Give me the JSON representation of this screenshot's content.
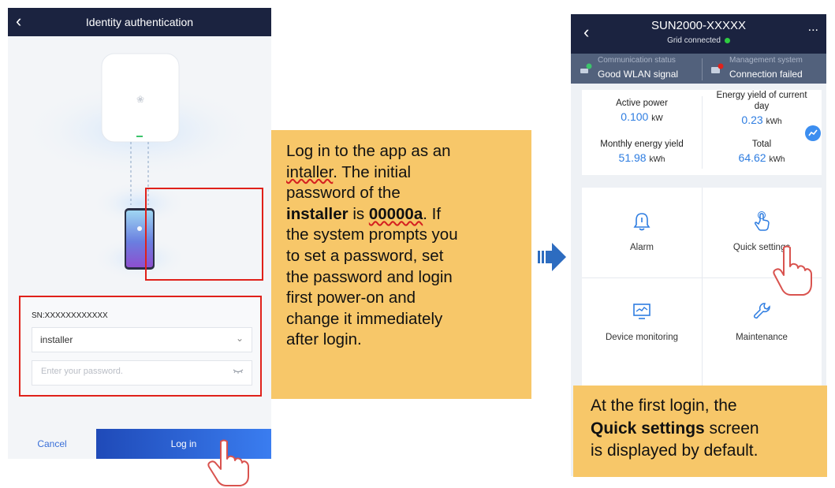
{
  "login_screen": {
    "title": "Identity authentication",
    "sn_label": "SN:XXXXXXXXXXXX",
    "username": "installer",
    "password_placeholder": "Enter your password.",
    "cancel_label": "Cancel",
    "login_label": "Log in"
  },
  "instruction": {
    "line1": "Log in to the app as an",
    "line2_word": "intaller",
    "line2_rest": ". The initial",
    "line3": "password of the",
    "line4_bold": "installer",
    "line4_mid": " is ",
    "line4_pw": "00000a",
    "line4_end": ". If",
    "line5": "the system prompts you",
    "line6": "to set a password, set",
    "line7": "the password and login",
    "line8": "first power-on and",
    "line9": "change it immediately",
    "line10": "after login."
  },
  "inverter_screen": {
    "title": "SUN2000-XXXXX",
    "status": "Grid connected",
    "more_label": "...",
    "comm_label": "Communication status",
    "comm_value": "Good WLAN signal",
    "mgmt_label": "Management system",
    "mgmt_value": "Connection failed",
    "active_power_label": "Active power",
    "active_power_value": "0.100",
    "active_power_unit": "kW",
    "daily_yield_label": "Energy yield of current day",
    "daily_yield_value": "0.23",
    "daily_yield_unit": "kWh",
    "monthly_yield_label": "Monthly energy yield",
    "monthly_yield_value": "51.98",
    "monthly_yield_unit": "kWh",
    "total_label": "Total",
    "total_value": "64.62",
    "total_unit": "kWh",
    "menu": {
      "alarm": "Alarm",
      "quick_settings": "Quick settings",
      "device_monitoring": "Device monitoring",
      "maintenance": "Maintenance"
    }
  },
  "note": {
    "line1": "At the first login, the",
    "line2_bold": "Quick settings",
    "line2_rest": " screen",
    "line3": "is displayed by default."
  },
  "colors": {
    "header": "#1b2340",
    "accent_blue": "#2e7de1",
    "highlight_red": "#e0211a",
    "callout": "#f7c769"
  }
}
